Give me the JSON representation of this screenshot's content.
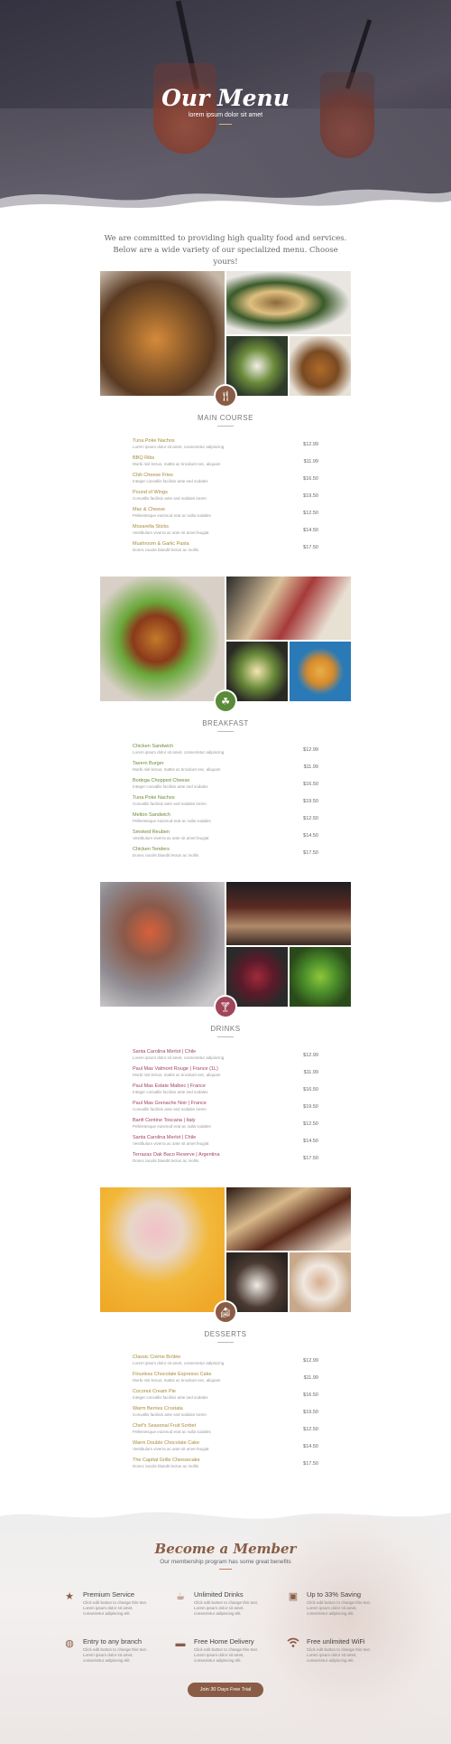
{
  "hero": {
    "title": "Our Menu",
    "subtitle": "lorem ipsum dolor sit amet"
  },
  "intro": "We are committed to providing high quality food and services. Below are a wide variety of our specialized menu. Choose yours!",
  "colors": {
    "brown": "#8a5c45",
    "green": "#5a8a3a",
    "maroon": "#a0455a",
    "gold": "#a88a3a",
    "greenName": "#6b8a3a"
  },
  "sections": [
    {
      "title": "MAIN COURSE",
      "icon": "fork-knife-icon",
      "badge_color": "#8a5c45",
      "name_color": "#a88a3a",
      "items": [
        {
          "name": "Tuna Poke Nachos",
          "desc": "Lorem ipsum dolor sit amet, consectetur adipiscing",
          "price": "$12.99"
        },
        {
          "name": "BBQ Ribs",
          "desc": "Morbi nisl lectus, mattis ac tincidunt nec, aliquam",
          "price": "$11.99"
        },
        {
          "name": "Chili Cheese Fries",
          "desc": "Integer convallis facilisis ante sed sodales",
          "price": "$16.50"
        },
        {
          "name": "Pound of Wings",
          "desc": "Convallis facilisis ante sed sodales lorem",
          "price": "$19.50"
        },
        {
          "name": "Mac & Cheese",
          "desc": "Pellentesque euismod erat ac nulla sodales",
          "price": "$12.50"
        },
        {
          "name": "Mozarella Sticks",
          "desc": "Vestibulum viverra ac ante sit amet feugiat",
          "price": "$14.50"
        },
        {
          "name": "Mushroom & Garlic Pasta",
          "desc": "Donec iaculis blandit lectus ac mollis",
          "price": "$17.50"
        }
      ]
    },
    {
      "title": "BREAKFAST",
      "icon": "leaf-icon",
      "badge_color": "#5a8a3a",
      "name_color": "#6b8a3a",
      "items": [
        {
          "name": "Chicken Sandwich",
          "desc": "Lorem ipsum dolor sit amet, consectetur adipiscing",
          "price": "$12.99"
        },
        {
          "name": "Tavern Burger",
          "desc": "Morbi nisl lectus, mattis ac tincidunt nec, aliquam",
          "price": "$11.99"
        },
        {
          "name": "Bodega Chopped Cheese",
          "desc": "Integer convallis facilisis ante sed sodales",
          "price": "$16.50"
        },
        {
          "name": "Tuna Poke Nachos",
          "desc": "Convallis facilisis ante sed sodales lorem",
          "price": "$19.50"
        },
        {
          "name": "Melton Sandwich",
          "desc": "Pellentesque euismod erat ac nulla sodales",
          "price": "$12.50"
        },
        {
          "name": "Smoked Reuben",
          "desc": "Vestibulum viverra ac ante sit amet feugiat",
          "price": "$14.50"
        },
        {
          "name": "Chicken Tenders",
          "desc": "Donec iaculis blandit lectus ac mollis",
          "price": "$17.50"
        }
      ]
    },
    {
      "title": "DRINKS",
      "icon": "cocktail-icon",
      "badge_color": "#a0455a",
      "name_color": "#a0455a",
      "items": [
        {
          "name": "Santa Carolina Merlot | Chile",
          "desc": "Lorem ipsum dolor sit amet, consectetur adipiscing",
          "price": "$12.99"
        },
        {
          "name": "Paul Mas Valmont Rouge | France (1L)",
          "desc": "Morbi nisl lectus, mattis ac tincidunt nec, aliquam",
          "price": "$11.99"
        },
        {
          "name": "Paul Mas Estate Malbec | France",
          "desc": "Integer convallis facilisis ante sed sodales",
          "price": "$16.50"
        },
        {
          "name": "Paul Mas Grenache Noir | France",
          "desc": "Convallis facilisis ante sed sodales lorem",
          "price": "$19.50"
        },
        {
          "name": "Banfi Centine Toscana | Italy",
          "desc": "Pellentesque euismod erat ac nulla sodales",
          "price": "$12.50"
        },
        {
          "name": "Santa Carolina Merlot | Chile",
          "desc": "Vestibulum viverra ac ante sit amet feugiat",
          "price": "$14.50"
        },
        {
          "name": "Terrazas Oak Baco Reserve | Argentina",
          "desc": "Donec iaculis blandit lectus ac mollis",
          "price": "$17.50"
        }
      ]
    },
    {
      "title": "DESSERTS",
      "icon": "cake-icon",
      "badge_color": "#8a5c45",
      "name_color": "#a88a3a",
      "items": [
        {
          "name": "Classic Crème Brûlée",
          "desc": "Lorem ipsum dolor sit amet, consectetur adipiscing",
          "price": "$12.99"
        },
        {
          "name": "Flourless Chocolate Espresso Cake",
          "desc": "Morbi nisl lectus, mattis ac tincidunt nec, aliquam",
          "price": "$11.99"
        },
        {
          "name": "Coconut Cream Pie",
          "desc": "Integer convallis facilisis ante sed sodales",
          "price": "$16.50"
        },
        {
          "name": "Warm Berries Crostata",
          "desc": "Convallis facilisis ante sed sodales lorem",
          "price": "$19.50"
        },
        {
          "name": "Chef's Seasonal Fruit Sorbet",
          "desc": "Pellentesque euismod erat ac nulla sodales",
          "price": "$12.50"
        },
        {
          "name": "Warm Double Chocolate Cake",
          "desc": "Vestibulum viverra ac ante sit amet feugiat",
          "price": "$14.50"
        },
        {
          "name": "The Capital Grille Cheesecake",
          "desc": "Donec iaculis blandit lectus ac mollis",
          "price": "$17.50"
        }
      ]
    }
  ],
  "member": {
    "title": "Become a Member",
    "subtitle": "Our membership program has some great benefits",
    "features": [
      {
        "title": "Premium Service",
        "icon": "star-icon",
        "desc": "Click edit button to change this text. Lorem ipsum dolor sit amet, consectetur adipiscing elit."
      },
      {
        "title": "Unlimited Drinks",
        "icon": "coffee-cup-icon",
        "desc": "Click edit button to change this text. Lorem ipsum dolor sit amet, consectetur adipiscing elit."
      },
      {
        "title": "Up to 33% Saving",
        "icon": "money-icon",
        "desc": "Click edit button to change this text. Lorem ipsum dolor sit amet, consectetur adipiscing elit."
      },
      {
        "title": "Entry to any branch",
        "icon": "globe-icon",
        "desc": "Click edit button to change this text. Lorem ipsum dolor sit amet, consectetur adipiscing elit."
      },
      {
        "title": "Free Home Delivery",
        "icon": "truck-icon",
        "desc": "Click edit button to change this text. Lorem ipsum dolor sit amet, consectetur adipiscing elit."
      },
      {
        "title": "Free unlimited WiFi",
        "icon": "wifi-icon",
        "desc": "Click edit button to change this text. Lorem ipsum dolor sit amet, consectetur adipiscing elit."
      }
    ],
    "button": "Join 30 Days Free Trial"
  }
}
